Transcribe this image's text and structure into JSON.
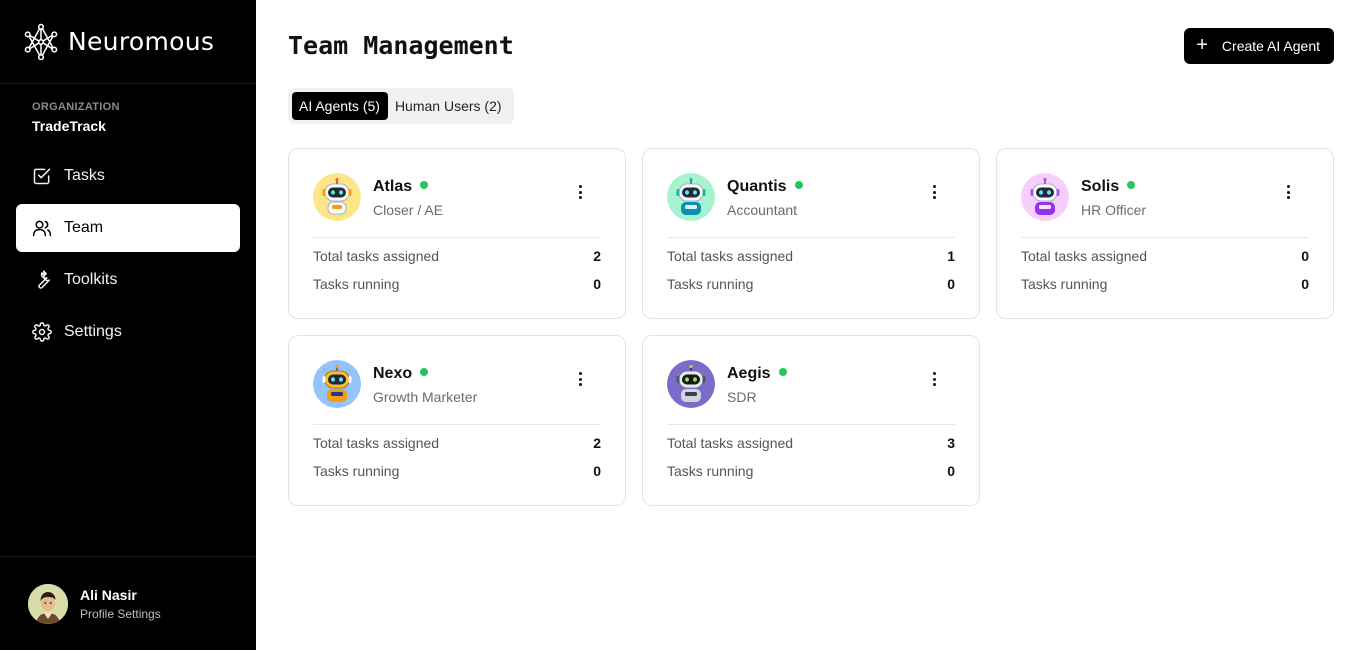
{
  "brand": {
    "name": "Neuromous"
  },
  "organization": {
    "label": "ORGANIZATION",
    "name": "TradeTrack"
  },
  "nav": [
    {
      "label": "Tasks",
      "icon": "tasks-icon",
      "active": false
    },
    {
      "label": "Team",
      "icon": "team-icon",
      "active": true
    },
    {
      "label": "Toolkits",
      "icon": "wrench-icon",
      "active": false
    },
    {
      "label": "Settings",
      "icon": "gear-icon",
      "active": false
    }
  ],
  "profile": {
    "name": "Ali Nasir",
    "subtitle": "Profile Settings"
  },
  "header": {
    "title": "Team Management",
    "create_label": "Create AI Agent"
  },
  "tabs": [
    {
      "label": "AI Agents (5)",
      "active": true
    },
    {
      "label": "Human Users (2)",
      "active": false
    }
  ],
  "agents": [
    {
      "name": "Atlas",
      "role": "Closer / AE",
      "status": "online",
      "status_color": "#22c55e",
      "avatar_bg": "#fde68a",
      "total_label": "Total tasks assigned",
      "total": "2",
      "running_label": "Tasks running",
      "running": "0"
    },
    {
      "name": "Quantis",
      "role": "Accountant",
      "status": "online",
      "status_color": "#22c55e",
      "avatar_bg": "#a7f3d0",
      "total_label": "Total tasks assigned",
      "total": "1",
      "running_label": "Tasks running",
      "running": "0"
    },
    {
      "name": "Solis",
      "role": "HR Officer",
      "status": "online",
      "status_color": "#22c55e",
      "avatar_bg": "#f5d0fe",
      "total_label": "Total tasks assigned",
      "total": "0",
      "running_label": "Tasks running",
      "running": "0"
    },
    {
      "name": "Nexo",
      "role": "Growth Marketer",
      "status": "online",
      "status_color": "#22c55e",
      "avatar_bg": "#93c5fd",
      "total_label": "Total tasks assigned",
      "total": "2",
      "running_label": "Tasks running",
      "running": "0"
    },
    {
      "name": "Aegis",
      "role": "SDR",
      "status": "online",
      "status_color": "#22c55e",
      "avatar_bg": "#7c6cc9",
      "total_label": "Total tasks assigned",
      "total": "3",
      "running_label": "Tasks running",
      "running": "0"
    }
  ]
}
